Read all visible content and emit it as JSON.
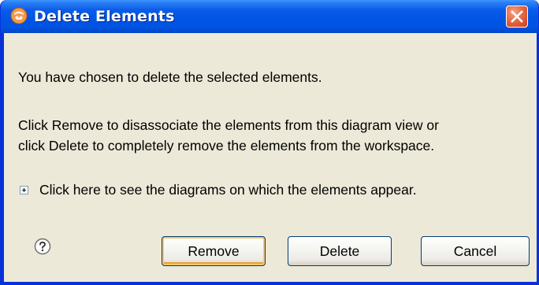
{
  "window": {
    "title": "Delete Elements",
    "icon": "eclipse-app-icon"
  },
  "controls": {
    "close_icon": "close-icon"
  },
  "message": {
    "line1": "You have chosen to delete the selected elements.",
    "line2": "Click Remove to disassociate the elements from this diagram view or",
    "line3": "click Delete to completely remove the elements from the workspace."
  },
  "details": {
    "expand_icon": "plus-box-icon",
    "label": "Click here to see the diagrams on which the elements appear."
  },
  "help": {
    "icon": "help-icon"
  },
  "buttons": {
    "remove": "Remove",
    "delete": "Delete",
    "cancel": "Cancel"
  },
  "colors": {
    "titlebar": "#0054e3",
    "client_background": "#ece9d8",
    "close_button": "#e56a45",
    "default_button_focus": "#f9c66d"
  }
}
